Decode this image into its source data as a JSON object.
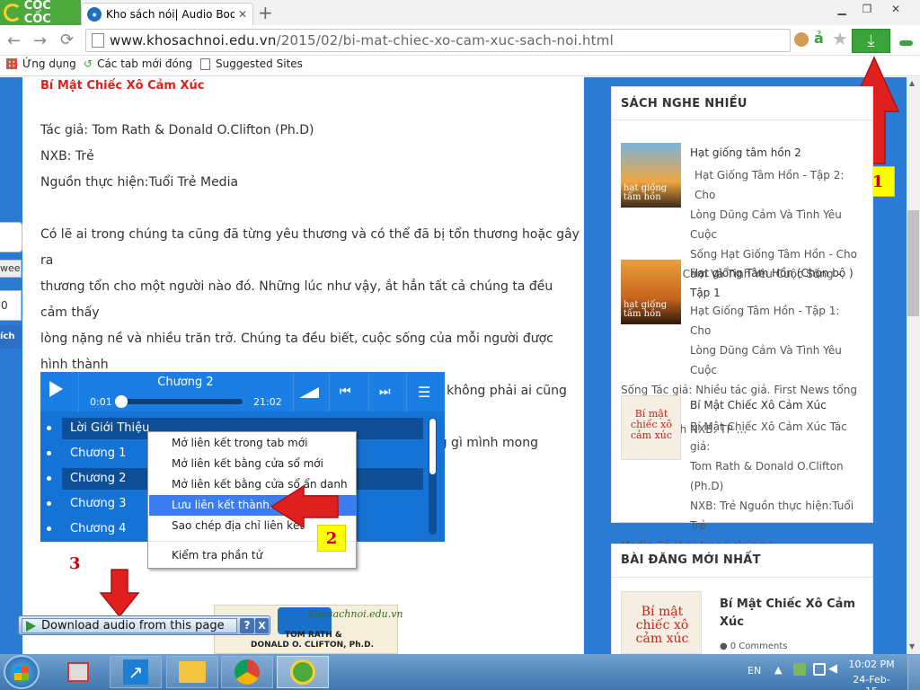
{
  "browser": {
    "brand": "CỐC CỐC",
    "tab_title": "Kho sách nói| Audio Book|",
    "url_domain": "www.khosachnoi.edu.vn",
    "url_path": "/2015/02/bi-mat-chiec-xo-cam-xuc-sach-noi.html",
    "new_tab": "+"
  },
  "bookmarks": [
    {
      "label": "Ứng dụng"
    },
    {
      "label": "Các tab mới đóng"
    },
    {
      "label": "Suggested Sites"
    }
  ],
  "article": {
    "title": "Bí Mật Chiếc Xô Cảm Xúc",
    "author": "Tác giả: Tom Rath & Donald O.Clifton (Ph.D)",
    "publisher": "NXB: Trẻ",
    "source": "Nguồn thực hiện:Tuổi Trẻ Media",
    "paragraph": [
      "Có lẽ ai trong chúng ta cũng đã từng yêu thương và có thể đã bị tổn thương hoặc gây ra",
      "thương tổn cho một người nào đó. Những lúc như vậy, ắt hẳn tất cả chúng ta đều cảm thấy",
      "lòng nặng nề và nhiều trăn trở. Chúng ta đều biết, cuộc sống của mỗi người được hình thành",
      "thông qua hàng loạt mối quan hệ tương tác trong xã hội, nhưng không phải ai cũng biết cách tự",
      "điều chỉnh thái độ để những mối quan hệ này diễn ra như những gì mình mong muốn."
    ]
  },
  "left_widget": {
    "tweet": "weet",
    "count": "0",
    "btn": "ích"
  },
  "player": {
    "track_title": "Chương 2",
    "time_current": "0:01",
    "time_total": "21:02",
    "playlist": [
      "Lời Giới Thiệu",
      "Chương 1",
      "Chương 2",
      "Chương 3",
      "Chương 4"
    ]
  },
  "context_menu": {
    "items": [
      "Mở liên kết trong tab mới",
      "Mở liên kết bằng cửa sổ mới",
      "Mở liên kết bằng cửa sổ ẩn danh",
      "Lưu liên kết thành...",
      "Sao chép địa chỉ liên kết",
      "Kiểm tra phần tử"
    ],
    "highlighted": "Lưu liên kết thành..."
  },
  "download_bar": {
    "label": "Download audio from this page",
    "help": "?",
    "close": "X"
  },
  "cover_bottom": {
    "brand": "Khosachnoi.edu.vn",
    "authors1": "TOM RATH &",
    "authors2": "DONALD O. CLIFTON, Ph.D."
  },
  "sidebar": {
    "popular_title": "SÁCH NGHE NHIỀU",
    "popular": [
      {
        "title": "Hạt giống tâm hồn 2",
        "desc": [
          "Hạt Giống Tâm Hồn - Tập 2: Cho",
          "Lòng Dũng Cảm Và Tình Yêu Cuộc",
          "Sống Hạt Giống Tâm Hồn - Cho",
          "Lòng Dũng Cảm Và Tình Yêu Cuộc Sống - Tập ..."
        ],
        "cover_text": "hạt giống tâm hồn"
      },
      {
        "title": "Hạt giống Tâm Hồn (Chọn bộ ) Tập 1",
        "desc": [
          "Hạt Giống Tâm Hồn - Tập 1: Cho",
          "Lòng Dũng Cảm Và Tình Yêu Cuộc",
          "Sống Tác giả: Nhiều tác giả. First News tổng hợp",
          "và biên dịch NXB: TP ..."
        ],
        "cover_text": "hạt giống tâm hồn"
      },
      {
        "title": "Bí Mật Chiếc Xô Cảm Xúc",
        "desc": [
          "Bí Mật Chiếc Xô Cảm Xúc Tác giả:",
          "Tom Rath & Donald O.Clifton (Ph.D)",
          "NXB: Trẻ Nguồn thực hiện:Tuổi Trẻ",
          "Media Có lẽ ai trong chúng t..."
        ],
        "cover_text": "Bí mật chiếc xô cảm xúc"
      }
    ],
    "latest_title": "BÀI ĐĂNG MỚI NHẤT",
    "latest": [
      {
        "title": "Bí Mật Chiếc Xô Cảm Xúc",
        "meta": "0 Comments",
        "cover_text": "Bí mật chiếc xô cảm xúc"
      }
    ]
  },
  "annotations": {
    "a1": "1",
    "a2": "2",
    "a3": "3"
  },
  "taskbar": {
    "lang": "EN",
    "time": "10:02 PM",
    "date": "24-Feb-15"
  },
  "colors": {
    "accent_red": "#e0201f",
    "brand_green": "#4caa3d",
    "page_blue": "#2b7ad3",
    "player_blue": "#1673d6"
  }
}
